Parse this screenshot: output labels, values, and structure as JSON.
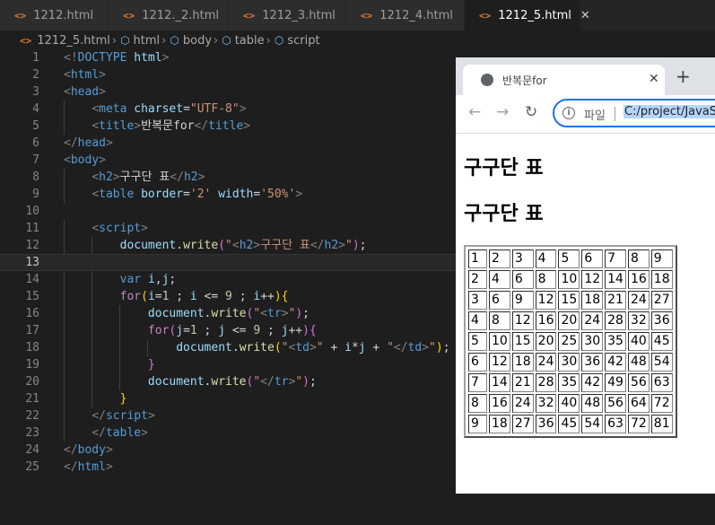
{
  "tabs": [
    {
      "label": "1212.html",
      "active": false
    },
    {
      "label": "1212._2.html",
      "active": false
    },
    {
      "label": "1212_3.html",
      "active": false
    },
    {
      "label": "1212_4.html",
      "active": false
    },
    {
      "label": "1212_5.html",
      "active": true
    }
  ],
  "breadcrumb": [
    "1212_5.html",
    "html",
    "body",
    "table",
    "script"
  ],
  "editor": {
    "current_line": 13,
    "lines": [
      [
        [
          "p",
          "<!"
        ],
        [
          "t",
          "DOCTYPE"
        ],
        [
          "d",
          " "
        ],
        [
          "a",
          "html"
        ],
        [
          "p",
          ">"
        ]
      ],
      [
        [
          "p",
          "<"
        ],
        [
          "t",
          "html"
        ],
        [
          "p",
          ">"
        ]
      ],
      [
        [
          "p",
          "<"
        ],
        [
          "t",
          "head"
        ],
        [
          "p",
          ">"
        ]
      ],
      [
        [
          "d",
          "    "
        ],
        [
          "p",
          "<"
        ],
        [
          "t",
          "meta"
        ],
        [
          "d",
          " "
        ],
        [
          "a",
          "charset"
        ],
        [
          "d",
          "="
        ],
        [
          "s",
          "\"UTF-8\""
        ],
        [
          "p",
          ">"
        ]
      ],
      [
        [
          "d",
          "    "
        ],
        [
          "p",
          "<"
        ],
        [
          "t",
          "title"
        ],
        [
          "p",
          ">"
        ],
        [
          "d",
          "반복문for"
        ],
        [
          "p",
          "</"
        ],
        [
          "t",
          "title"
        ],
        [
          "p",
          ">"
        ]
      ],
      [
        [
          "p",
          "</"
        ],
        [
          "t",
          "head"
        ],
        [
          "p",
          ">"
        ]
      ],
      [
        [
          "p",
          "<"
        ],
        [
          "t",
          "body"
        ],
        [
          "p",
          ">"
        ]
      ],
      [
        [
          "d",
          "    "
        ],
        [
          "p",
          "<"
        ],
        [
          "t",
          "h2"
        ],
        [
          "p",
          ">"
        ],
        [
          "d",
          "구구단 표"
        ],
        [
          "p",
          "</"
        ],
        [
          "t",
          "h2"
        ],
        [
          "p",
          ">"
        ]
      ],
      [
        [
          "d",
          "    "
        ],
        [
          "p",
          "<"
        ],
        [
          "t",
          "table"
        ],
        [
          "d",
          " "
        ],
        [
          "a",
          "border"
        ],
        [
          "d",
          "="
        ],
        [
          "s",
          "'2'"
        ],
        [
          "d",
          " "
        ],
        [
          "a",
          "width"
        ],
        [
          "d",
          "="
        ],
        [
          "s",
          "'50%'"
        ],
        [
          "p",
          ">"
        ]
      ],
      [],
      [
        [
          "d",
          "    "
        ],
        [
          "p",
          "<"
        ],
        [
          "t",
          "script"
        ],
        [
          "p",
          ">"
        ]
      ],
      [
        [
          "d",
          "        "
        ],
        [
          "v",
          "document"
        ],
        [
          "d",
          "."
        ],
        [
          "f",
          "write"
        ],
        [
          "b2",
          "("
        ],
        [
          "s",
          "\""
        ],
        [
          "p",
          "<"
        ],
        [
          "t",
          "h2"
        ],
        [
          "p",
          ">"
        ],
        [
          "s",
          "구구단 표"
        ],
        [
          "p",
          "</"
        ],
        [
          "t",
          "h2"
        ],
        [
          "p",
          ">"
        ],
        [
          "s",
          "\""
        ],
        [
          "b2",
          ")"
        ],
        [
          "d",
          ";"
        ]
      ],
      [],
      [
        [
          "d",
          "        "
        ],
        [
          "t",
          "var"
        ],
        [
          "d",
          " "
        ],
        [
          "v",
          "i"
        ],
        [
          "d",
          ","
        ],
        [
          "v",
          "j"
        ],
        [
          "d",
          ";"
        ]
      ],
      [
        [
          "d",
          "        "
        ],
        [
          "k",
          "for"
        ],
        [
          "b1",
          "("
        ],
        [
          "v",
          "i"
        ],
        [
          "d",
          "="
        ],
        [
          "n",
          "1"
        ],
        [
          "d",
          " ; "
        ],
        [
          "v",
          "i"
        ],
        [
          "d",
          " <= "
        ],
        [
          "n",
          "9"
        ],
        [
          "d",
          " ; "
        ],
        [
          "v",
          "i"
        ],
        [
          "d",
          "++"
        ],
        [
          "b1",
          ")"
        ],
        [
          "b1",
          "{"
        ]
      ],
      [
        [
          "d",
          "            "
        ],
        [
          "v",
          "document"
        ],
        [
          "d",
          "."
        ],
        [
          "f",
          "write"
        ],
        [
          "b2",
          "("
        ],
        [
          "s",
          "\""
        ],
        [
          "p",
          "<"
        ],
        [
          "t",
          "tr"
        ],
        [
          "p",
          ">"
        ],
        [
          "s",
          "\""
        ],
        [
          "b2",
          ")"
        ],
        [
          "d",
          ";"
        ]
      ],
      [
        [
          "d",
          "            "
        ],
        [
          "k",
          "for"
        ],
        [
          "b2",
          "("
        ],
        [
          "v",
          "j"
        ],
        [
          "d",
          "="
        ],
        [
          "n",
          "1"
        ],
        [
          "d",
          " ; "
        ],
        [
          "v",
          "j"
        ],
        [
          "d",
          " <= "
        ],
        [
          "n",
          "9"
        ],
        [
          "d",
          " ; "
        ],
        [
          "v",
          "j"
        ],
        [
          "d",
          "++"
        ],
        [
          "b2",
          ")"
        ],
        [
          "b2",
          "{"
        ]
      ],
      [
        [
          "d",
          "                "
        ],
        [
          "v",
          "document"
        ],
        [
          "d",
          "."
        ],
        [
          "f",
          "write"
        ],
        [
          "b1",
          "("
        ],
        [
          "s",
          "\""
        ],
        [
          "p",
          "<"
        ],
        [
          "t",
          "td"
        ],
        [
          "p",
          ">"
        ],
        [
          "s",
          "\""
        ],
        [
          "d",
          " + "
        ],
        [
          "v",
          "i"
        ],
        [
          "d",
          "*"
        ],
        [
          "v",
          "j"
        ],
        [
          "d",
          " + "
        ],
        [
          "s",
          "\""
        ],
        [
          "p",
          "</"
        ],
        [
          "t",
          "td"
        ],
        [
          "p",
          ">"
        ],
        [
          "s",
          "\""
        ],
        [
          "b1",
          ")"
        ],
        [
          "d",
          ";"
        ]
      ],
      [
        [
          "d",
          "            "
        ],
        [
          "b2",
          "}"
        ]
      ],
      [
        [
          "d",
          "            "
        ],
        [
          "v",
          "document"
        ],
        [
          "d",
          "."
        ],
        [
          "f",
          "write"
        ],
        [
          "b2",
          "("
        ],
        [
          "s",
          "\""
        ],
        [
          "p",
          "</"
        ],
        [
          "t",
          "tr"
        ],
        [
          "p",
          ">"
        ],
        [
          "s",
          "\""
        ],
        [
          "b2",
          ")"
        ],
        [
          "d",
          ";"
        ]
      ],
      [
        [
          "d",
          "        "
        ],
        [
          "b1",
          "}"
        ]
      ],
      [
        [
          "d",
          "    "
        ],
        [
          "p",
          "</"
        ],
        [
          "t",
          "script"
        ],
        [
          "p",
          ">"
        ]
      ],
      [
        [
          "d",
          "    "
        ],
        [
          "p",
          "</"
        ],
        [
          "t",
          "table"
        ],
        [
          "p",
          ">"
        ]
      ],
      [
        [
          "p",
          "</"
        ],
        [
          "t",
          "body"
        ],
        [
          "p",
          ">"
        ]
      ],
      [
        [
          "p",
          "</"
        ],
        [
          "t",
          "html"
        ],
        [
          "p",
          ">"
        ]
      ]
    ]
  },
  "browser": {
    "tab_title": "반복문for",
    "close_glyph": "✕",
    "new_tab_glyph": "+",
    "file_label": "파일",
    "url": "C:/project/JavaScript",
    "headings": [
      "구구단 표",
      "구구단 표"
    ],
    "table": [
      [
        "1",
        "2",
        "3",
        "4",
        "5",
        "6",
        "7",
        "8",
        "9"
      ],
      [
        "2",
        "4",
        "6",
        "8",
        "10",
        "12",
        "14",
        "16",
        "18"
      ],
      [
        "3",
        "6",
        "9",
        "12",
        "15",
        "18",
        "21",
        "24",
        "27"
      ],
      [
        "4",
        "8",
        "12",
        "16",
        "20",
        "24",
        "28",
        "32",
        "36"
      ],
      [
        "5",
        "10",
        "15",
        "20",
        "25",
        "30",
        "35",
        "40",
        "45"
      ],
      [
        "6",
        "12",
        "18",
        "24",
        "30",
        "36",
        "42",
        "48",
        "54"
      ],
      [
        "7",
        "14",
        "21",
        "28",
        "35",
        "42",
        "49",
        "56",
        "63"
      ],
      [
        "8",
        "16",
        "24",
        "32",
        "40",
        "48",
        "56",
        "64",
        "72"
      ],
      [
        "9",
        "18",
        "27",
        "36",
        "45",
        "54",
        "63",
        "72",
        "81"
      ]
    ]
  }
}
